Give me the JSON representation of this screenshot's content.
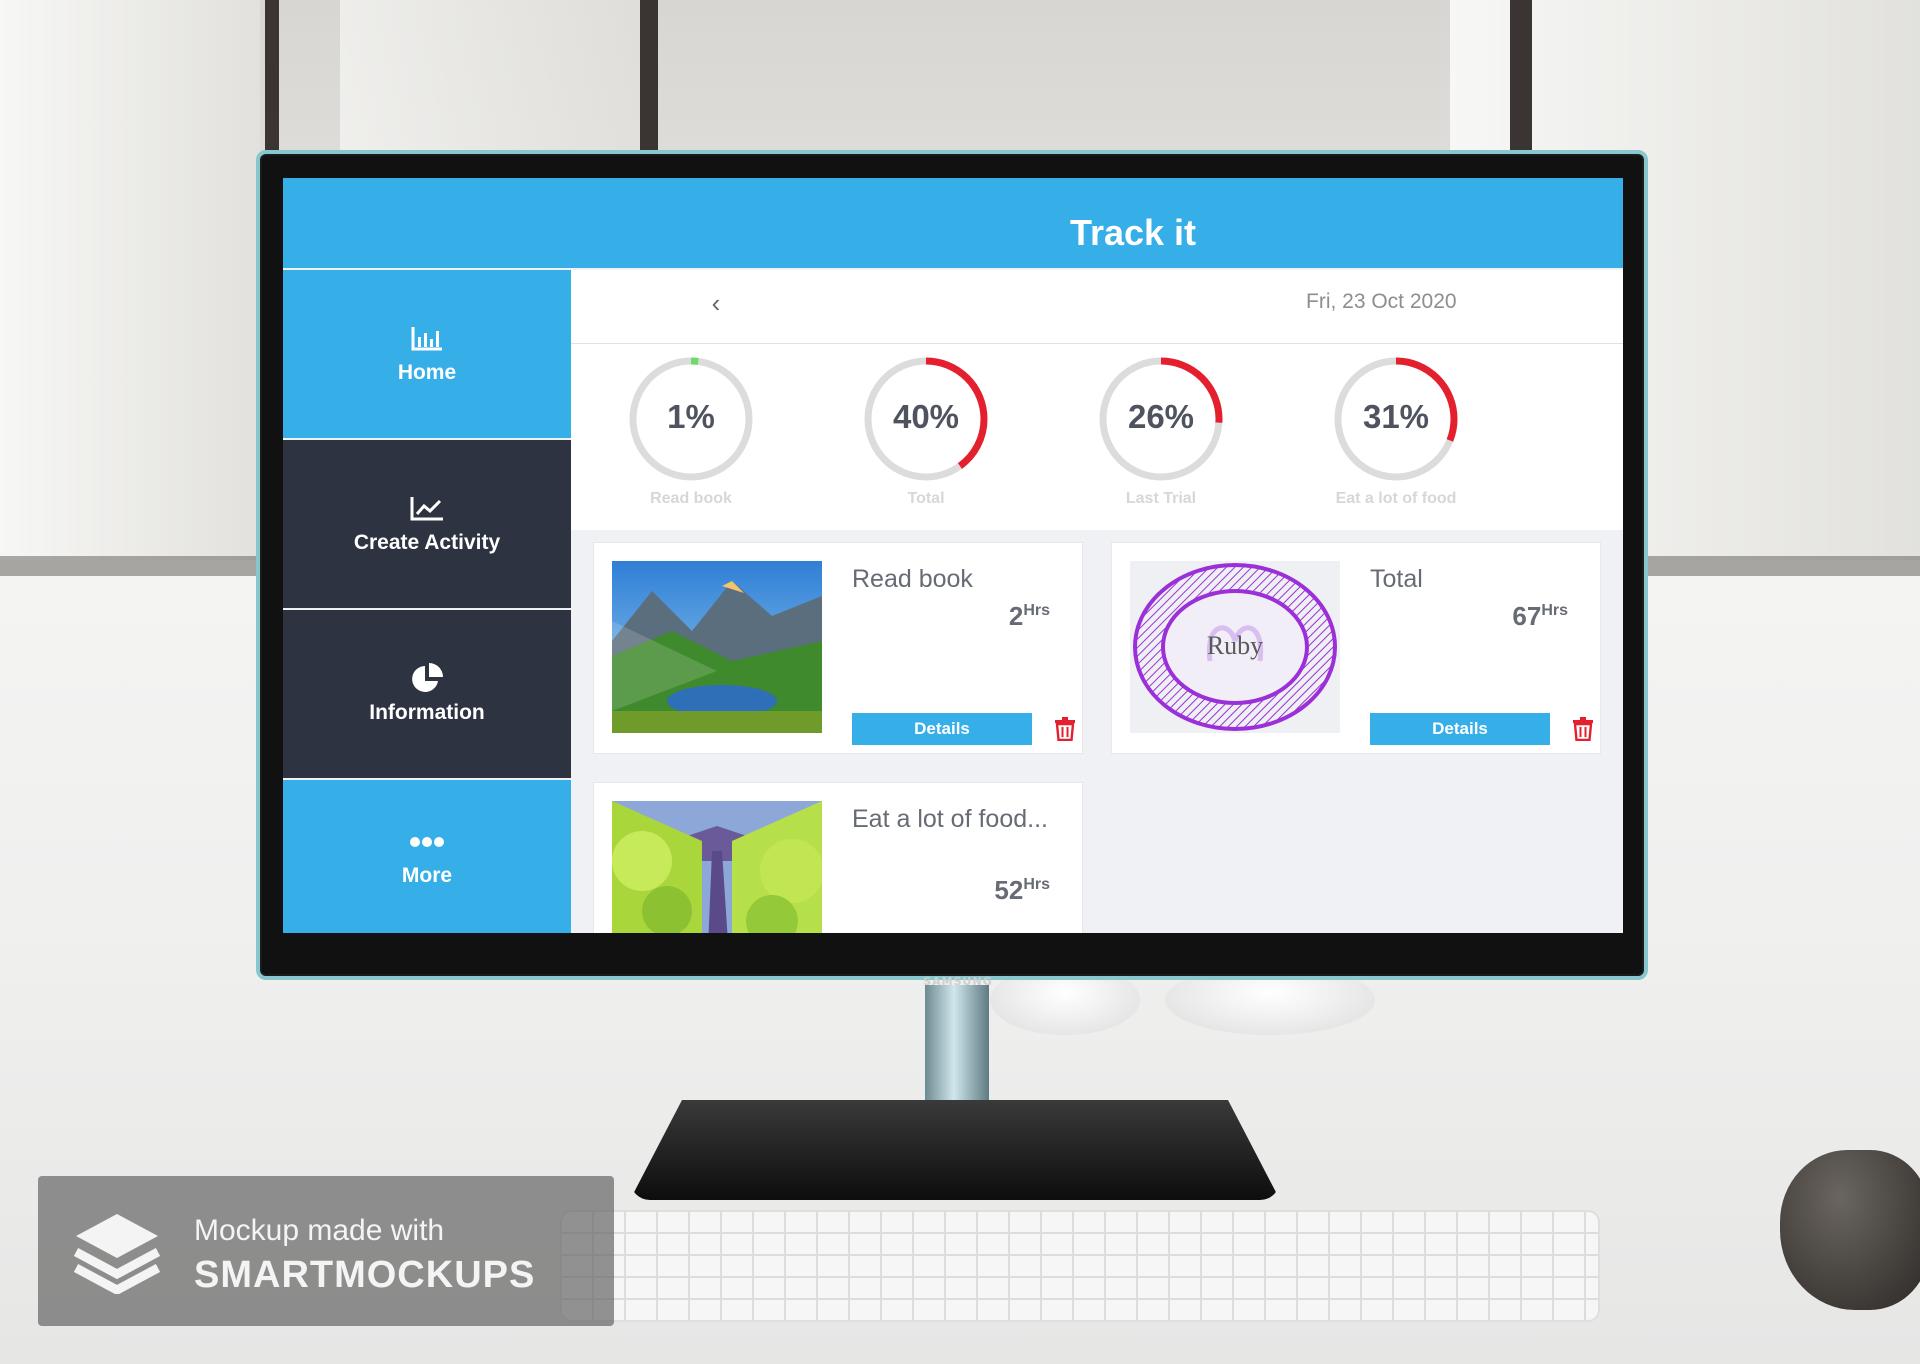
{
  "app": {
    "title": "Track it",
    "accent_color": "#36aee8",
    "sidebar_dark_color": "#2d3340"
  },
  "sidebar": {
    "items": [
      {
        "label": "Home",
        "icon": "bar-chart-icon",
        "active": true
      },
      {
        "label": "Create Activity",
        "icon": "line-chart-icon",
        "active": false
      },
      {
        "label": "Information",
        "icon": "pie-chart-icon",
        "active": false
      },
      {
        "label": "More",
        "icon": "more-dots-icon",
        "active": false
      }
    ]
  },
  "date_bar": {
    "back_icon": "chevron-left-icon",
    "date": "Fri, 23 Oct 2020"
  },
  "progress_rings": [
    {
      "value_text": "1%",
      "label": "Read book",
      "progress": 0.01,
      "color": "#6fd96a"
    },
    {
      "value_text": "40%",
      "label": "Total",
      "progress": 0.4,
      "color": "#e4202e"
    },
    {
      "value_text": "26%",
      "label": "Last Trial",
      "progress": 0.26,
      "color": "#e4202e"
    },
    {
      "value_text": "31%",
      "label": "Eat a lot of food",
      "progress": 0.31,
      "color": "#e4202e"
    }
  ],
  "cards": [
    {
      "title": "Read book",
      "hours": "2",
      "unit": "Hrs",
      "button": "Details",
      "image": "mountain-lake-image"
    },
    {
      "title": "Total",
      "hours": "67",
      "unit": "Hrs",
      "button": "Details",
      "image": "ruby-logo-image",
      "image_text": "Ruby"
    },
    {
      "title": "Eat a lot of food...",
      "hours": "52",
      "unit": "Hrs",
      "image": "tree-avenue-image"
    }
  ],
  "monitor": {
    "brand": "SAMSUNG"
  },
  "watermark": {
    "line1": "Mockup made with",
    "line2": "SMARTMOCKUPS"
  }
}
